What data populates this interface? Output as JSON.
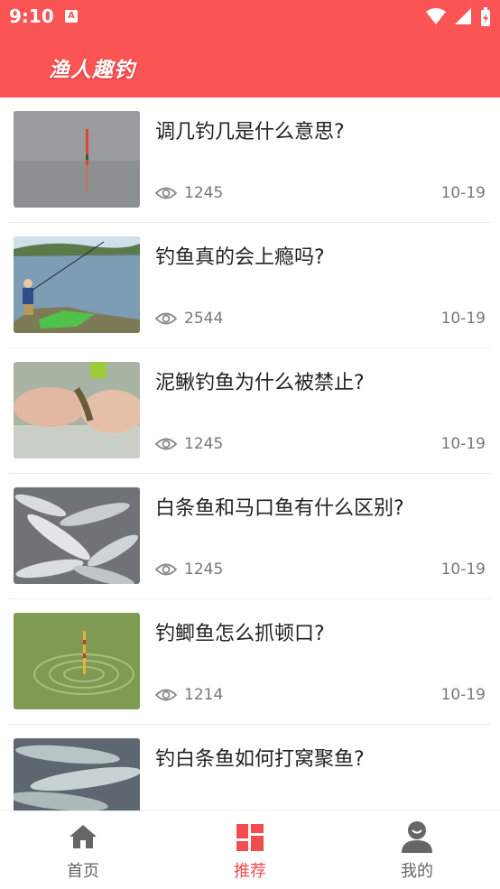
{
  "status_bar": {
    "time": "9:10",
    "notification_letter": "A",
    "icons": [
      "wifi-icon",
      "cellular-signal-icon",
      "battery-charging-icon"
    ]
  },
  "header": {
    "title": "渔人趣钓",
    "background_color": "#fb5454"
  },
  "articles": [
    {
      "title": "调几钓几是什么意思?",
      "views": "1245",
      "date": "10-19",
      "image": "fishing-float-in-water"
    },
    {
      "title": "钓鱼真的会上瘾吗?",
      "views": "2544",
      "date": "10-19",
      "image": "angler-by-lake"
    },
    {
      "title": "泥鳅钓鱼为什么被禁止?",
      "views": "1245",
      "date": "10-19",
      "image": "hands-holding-loach"
    },
    {
      "title": "白条鱼和马口鱼有什么区别?",
      "views": "1245",
      "date": "10-19",
      "image": "pile-of-small-fish"
    },
    {
      "title": "钓鲫鱼怎么抓顿口?",
      "views": "1214",
      "date": "10-19",
      "image": "float-ripples-green-water"
    },
    {
      "title": "钓白条鱼如何打窝聚鱼?",
      "views": "",
      "date": "",
      "image": "silver-fish-close-up"
    }
  ],
  "tabbar": {
    "tabs": [
      {
        "label": "首页",
        "icon": "home-icon",
        "active": false
      },
      {
        "label": "推荐",
        "icon": "grid-icon",
        "active": true
      },
      {
        "label": "我的",
        "icon": "user-icon",
        "active": false
      }
    ],
    "active_color": "#f24c4c",
    "inactive_color": "#666666"
  }
}
